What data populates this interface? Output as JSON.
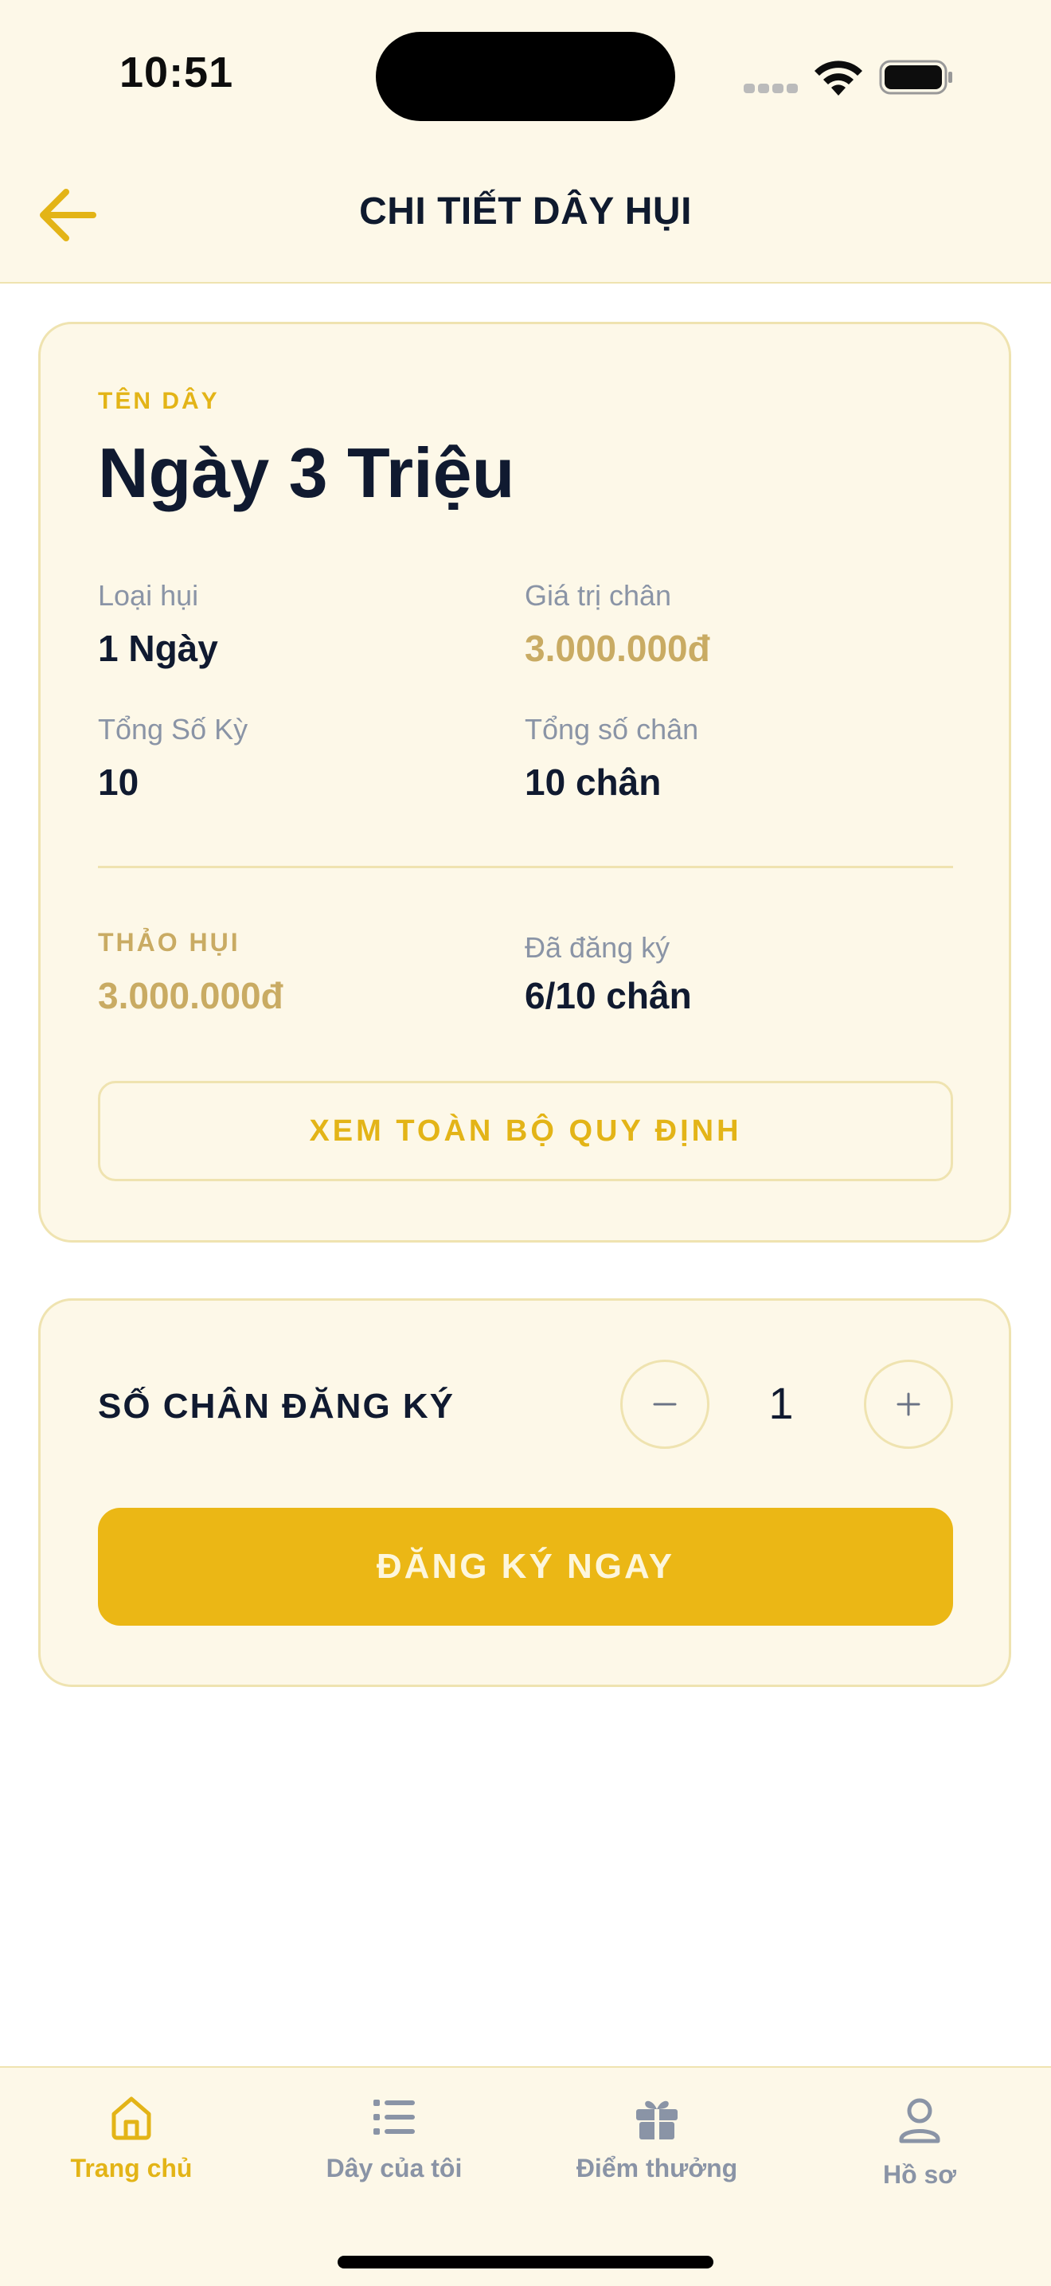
{
  "status_bar": {
    "time": "10:51"
  },
  "header": {
    "title": "CHI TIẾT DÂY HỤI"
  },
  "detail": {
    "name_label": "TÊN DÂY",
    "name": "Ngày 3 Triệu",
    "type_label": "Loại hụi",
    "type_value": "1 Ngày",
    "leg_value_label": "Giá trị chân",
    "leg_value": "3.000.000đ",
    "total_periods_label": "Tổng Số Kỳ",
    "total_periods": "10",
    "total_legs_label": "Tổng số chân",
    "total_legs": "10 chân",
    "payout_label": "THẢO HỤI",
    "payout_value": "3.000.000đ",
    "registered_label": "Đã đăng ký",
    "registered_value": "6/10 chân",
    "rules_button": "XEM TOÀN BỘ QUY ĐỊNH"
  },
  "registration": {
    "label": "SỐ CHÂN ĐĂNG KÝ",
    "quantity": "1",
    "submit_button": "ĐĂNG KÝ NGAY"
  },
  "bottom_nav": {
    "items": [
      {
        "label": "Trang chủ",
        "icon": "home-icon",
        "active": true
      },
      {
        "label": "Dây của tôi",
        "icon": "list-icon",
        "active": false
      },
      {
        "label": "Điểm thưởng",
        "icon": "gift-icon",
        "active": false
      },
      {
        "label": "Hồ sơ",
        "icon": "user-icon",
        "active": false
      }
    ]
  },
  "colors": {
    "accent": "#EBB715",
    "background_cream": "#FDF8E8",
    "border": "#EFE3B0",
    "text_dark": "#101A30",
    "text_muted": "#8A94A6",
    "money_gold": "#C9AB63"
  }
}
